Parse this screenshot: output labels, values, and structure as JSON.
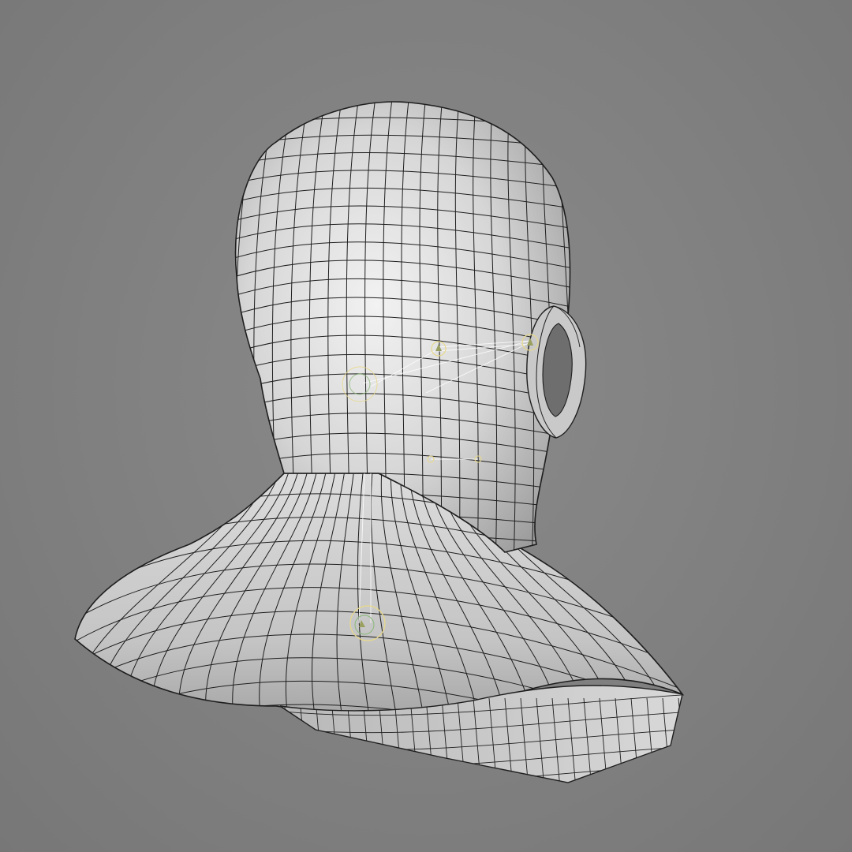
{
  "viewport": {
    "background_color": "#808080",
    "mesh_color": "#c8c8c8",
    "wire_color": "#1e1e1e",
    "rig_color": "#ffffff",
    "rig_accent_color": "#e8d98a"
  },
  "scene": {
    "object": "head-and-shoulders-mesh",
    "display_mode": "shaded-with-wireframe",
    "rig_joints": [
      "jaw-joint",
      "head-joint",
      "neck-joint",
      "ear-joint",
      "spine-joint"
    ]
  }
}
